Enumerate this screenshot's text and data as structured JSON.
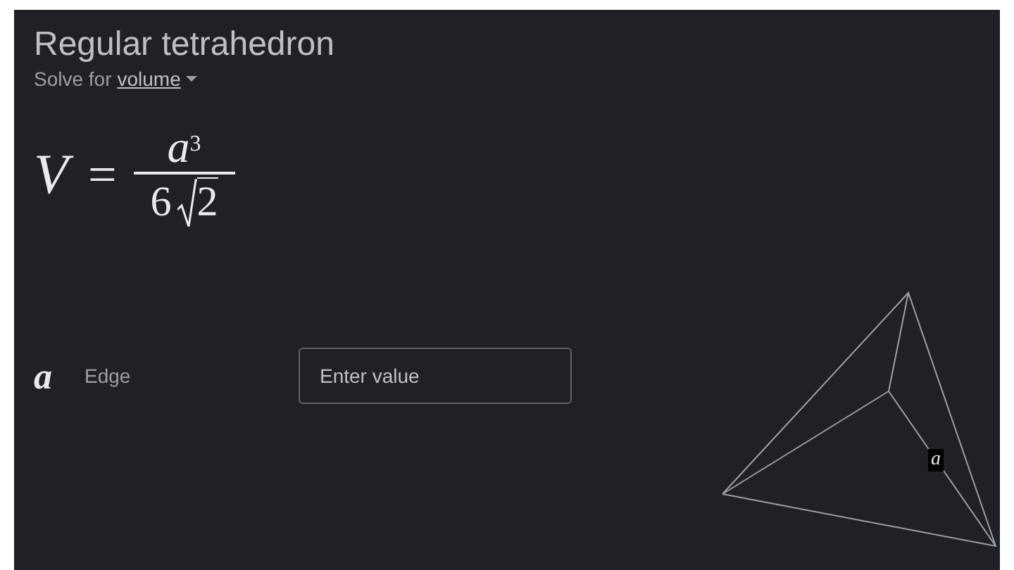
{
  "title": "Regular tetrahedron",
  "solve_for": {
    "prefix": "Solve for",
    "option": "volume"
  },
  "formula": {
    "lhs": "V",
    "operator": "=",
    "numerator": "a",
    "exponent": "3",
    "coefficient": "6",
    "radicand": "2"
  },
  "inputs": [
    {
      "symbol": "a",
      "label": "Edge",
      "placeholder": "Enter value"
    }
  ],
  "diagram": {
    "edge_label": "a"
  }
}
